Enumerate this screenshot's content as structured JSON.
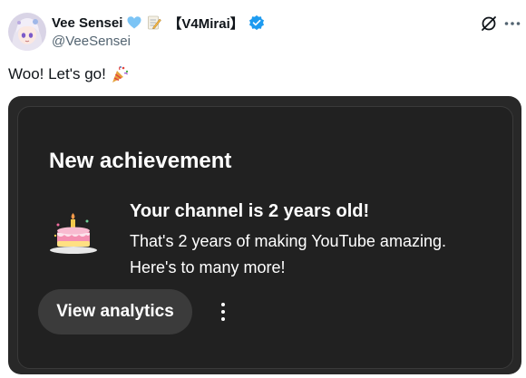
{
  "author": {
    "display_name": "Vee Sensei",
    "tag": "【V4Mirai】",
    "handle": "@VeeSensei",
    "avatar_icon": "anime-avatar-icon",
    "name_emojis": [
      "light-blue-heart-icon",
      "memo-icon"
    ],
    "verified_icon": "verified-badge-icon",
    "verified_color": "#1d9bf0"
  },
  "header_actions": {
    "grok_icon": "grok-icon",
    "more_icon": "more-horizontal-icon"
  },
  "tweet": {
    "text": "Woo! Let's go!",
    "emoji": "party-popper-icon"
  },
  "achievement_card": {
    "title": "New achievement",
    "headline": "Your channel is 2 years old!",
    "line1": "That's 2 years of making YouTube amazing.",
    "line2": "Here's to many more!",
    "button_label": "View analytics",
    "icon": "birthday-cake-icon",
    "menu_icon": "more-vertical-icon",
    "background_color": "#212121"
  }
}
